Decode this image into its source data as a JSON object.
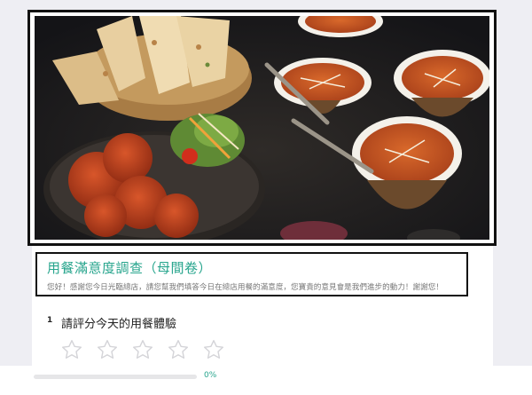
{
  "survey": {
    "title": "用餐滿意度調查（母間卷）",
    "description": "您好！感謝您今日光臨總店，請您幫我們填答今日在總店用餐的滿意度，您寶貴的意見會是我們進步的動力！謝謝您！"
  },
  "question": {
    "number": "1",
    "text": "請評分今天的用餐體驗",
    "max_rating": 5,
    "rating": 0,
    "icon": "star-outline-icon"
  },
  "progress": {
    "value": 0,
    "label": "0%"
  },
  "colors": {
    "accent": "#27a58d",
    "star_outline": "#d4d4d8",
    "page_background": "#eeeef3"
  }
}
